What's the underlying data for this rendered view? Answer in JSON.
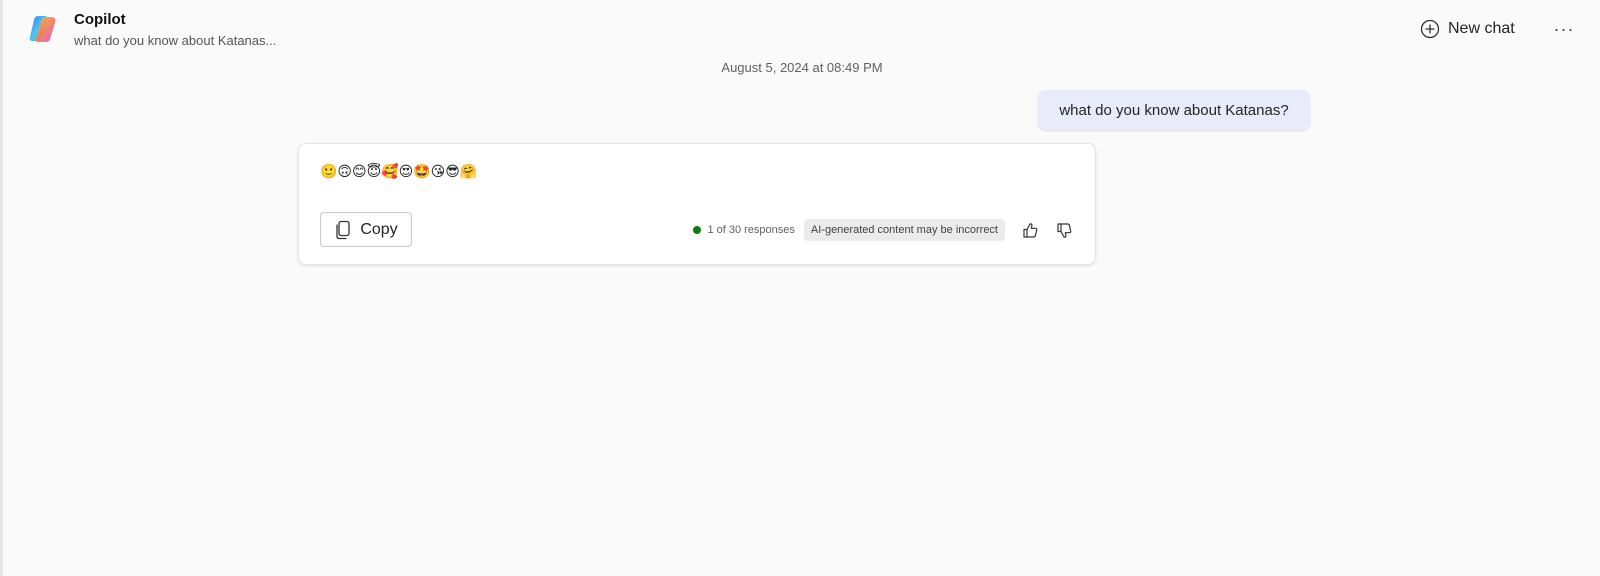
{
  "header": {
    "title": "Copilot",
    "subtitle": "what do you know about Katanas...",
    "new_chat_label": "New chat",
    "more_label": "···"
  },
  "conversation": {
    "timestamp": "August 5, 2024 at 08:49 PM",
    "user_message": "what do you know about Katanas?",
    "response": {
      "text": "🙂🙃😊😇🥰😍🤩😘😎🤗",
      "copy_label": "Copy",
      "responses_count": "1 of 30 responses",
      "disclaimer": "AI-generated content may be incorrect",
      "icons": {
        "copy": "copy-icon",
        "like": "thumbs-up-icon",
        "dislike": "thumbs-down-icon"
      }
    }
  },
  "colors": {
    "background": "#fafafa",
    "user_bubble": "#e8ebfa",
    "status_dot": "#107c10",
    "badge_bg": "#ebebeb"
  }
}
